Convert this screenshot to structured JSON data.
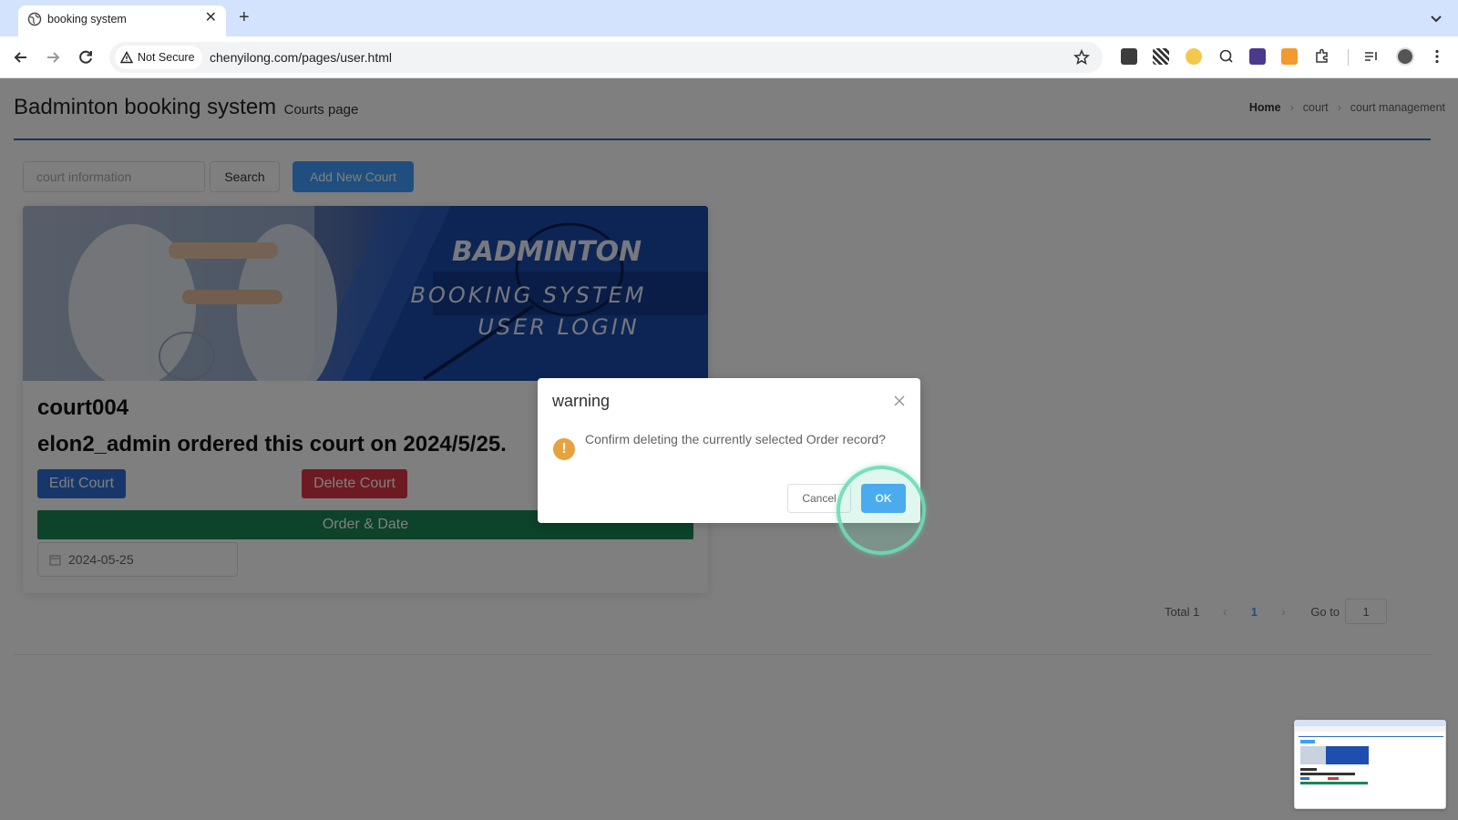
{
  "browser": {
    "tab_title": "booking system",
    "security_label": "Not Secure",
    "url": "chenyilong.com/pages/user.html"
  },
  "page": {
    "title": "Badminton booking system",
    "subtitle": "Courts page",
    "breadcrumb": [
      "Home",
      "court",
      "court management"
    ]
  },
  "toolbar": {
    "search_placeholder": "court information",
    "search_label": "Search",
    "add_label": "Add New Court"
  },
  "banner": {
    "line1": "BADMINTON",
    "line2": "BOOKING SYSTEM",
    "line3": "USER LOGIN"
  },
  "court": {
    "name": "court004",
    "order_text": "elon2_admin ordered this court on 2024/5/25.",
    "edit_label": "Edit Court",
    "delete_label": "Delete Court",
    "order_bar_label": "Order & Date",
    "date_value": "2024-05-25"
  },
  "pagination": {
    "total_label": "Total 1",
    "current_page": "1",
    "goto_label": "Go to",
    "goto_value": "1"
  },
  "dialog": {
    "title": "warning",
    "message": "Confirm deleting the currently selected Order record?",
    "cancel_label": "Cancel",
    "ok_label": "OK"
  },
  "colors": {
    "primary": "#409eff",
    "danger": "#dc3545",
    "success": "#198754",
    "warning": "#e6a23c",
    "header_line": "#2e6db4"
  }
}
